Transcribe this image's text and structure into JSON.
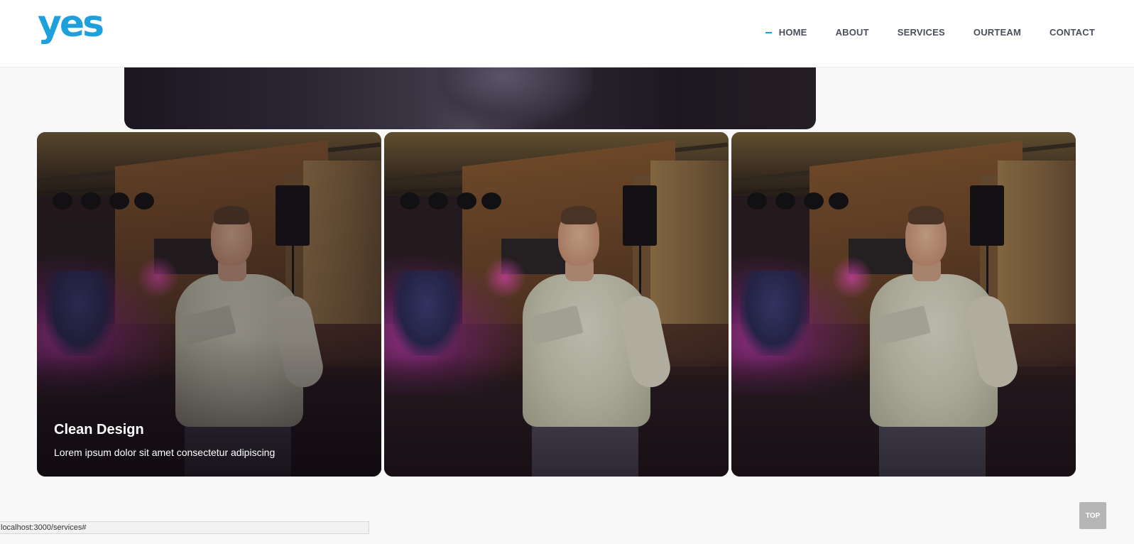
{
  "header": {
    "logo": "yes",
    "nav": [
      {
        "label": "HOME",
        "active": true
      },
      {
        "label": "ABOUT"
      },
      {
        "label": "SERVICES"
      },
      {
        "label": "OURTEAM"
      },
      {
        "label": "CONTACT"
      }
    ],
    "accent_color": "#1ea0dc"
  },
  "cards": [
    {
      "title": "Clean Design",
      "text": "Lorem ipsum dolor sit amet consectetur adipiscing"
    }
  ],
  "status_bar": {
    "url": "localhost:3000/services#"
  },
  "top_button": {
    "label": "TOP"
  }
}
